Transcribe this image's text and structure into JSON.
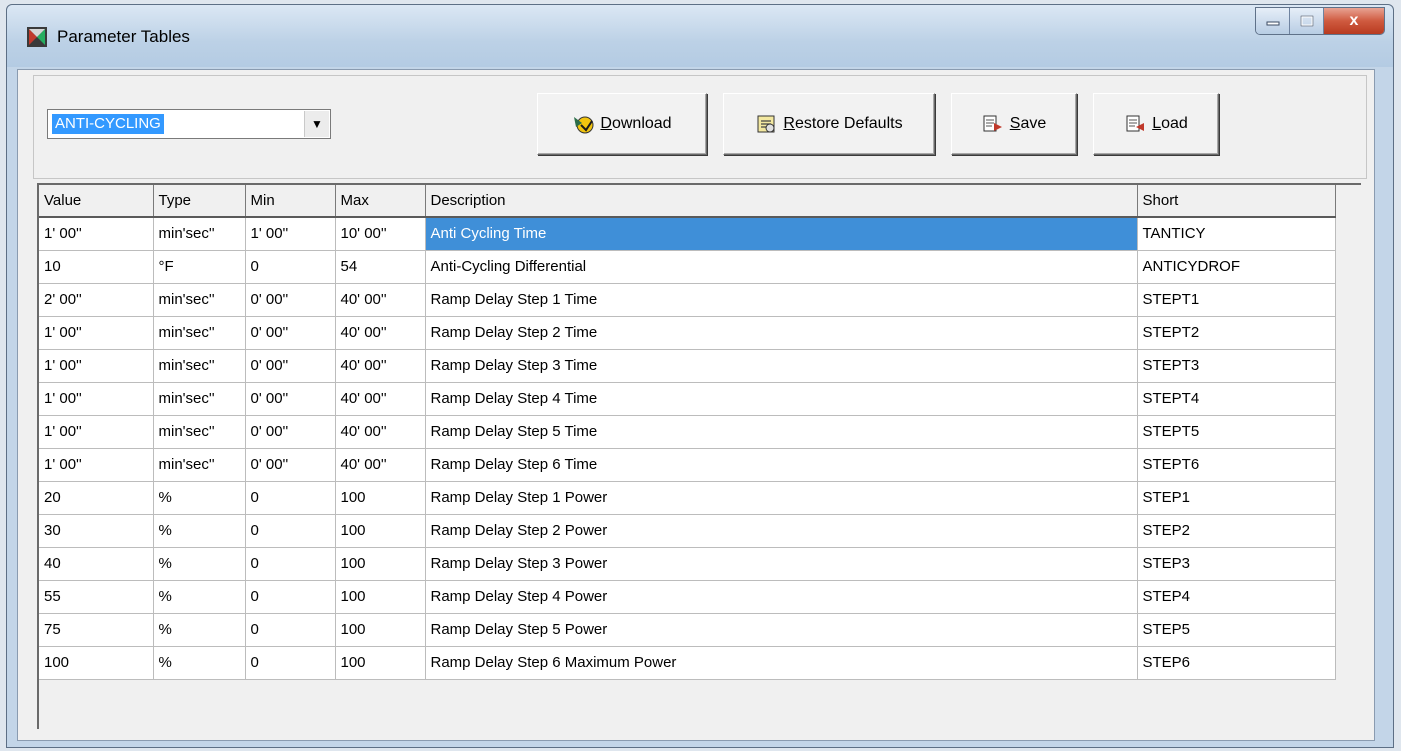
{
  "window": {
    "title": "Parameter Tables",
    "close_glyph": "x"
  },
  "toolbar": {
    "table_select": {
      "selected": "ANTI-CYCLING"
    },
    "buttons": {
      "download": {
        "underline": "D",
        "rest": "ownload",
        "icon": "download-icon"
      },
      "restore": {
        "underline": "R",
        "rest": "estore Defaults",
        "icon": "restore-defaults-icon"
      },
      "save": {
        "underline": "S",
        "rest": "ave",
        "icon": "save-icon"
      },
      "load": {
        "underline": "L",
        "rest": "oad",
        "icon": "load-icon"
      }
    }
  },
  "table": {
    "columns": [
      "Value",
      "Type",
      "Min",
      "Max",
      "Description",
      "Short"
    ],
    "rows": [
      [
        "1' 00''",
        "min'sec''",
        "1' 00''",
        "10' 00''",
        "Anti Cycling Time",
        "TANTICY"
      ],
      [
        "10",
        "°F",
        "0",
        "54",
        "Anti-Cycling Differential",
        "ANTICYDROF"
      ],
      [
        "2' 00''",
        "min'sec''",
        "0' 00''",
        "40' 00''",
        "Ramp Delay Step 1 Time",
        "STEPT1"
      ],
      [
        "1' 00''",
        "min'sec''",
        "0' 00''",
        "40' 00''",
        "Ramp Delay Step 2 Time",
        "STEPT2"
      ],
      [
        "1' 00''",
        "min'sec''",
        "0' 00''",
        "40' 00''",
        "Ramp Delay Step 3 Time",
        "STEPT3"
      ],
      [
        "1' 00''",
        "min'sec''",
        "0' 00''",
        "40' 00''",
        "Ramp Delay Step 4 Time",
        "STEPT4"
      ],
      [
        "1' 00''",
        "min'sec''",
        "0' 00''",
        "40' 00''",
        "Ramp Delay Step 5 Time",
        "STEPT5"
      ],
      [
        "1' 00''",
        "min'sec''",
        "0' 00''",
        "40' 00''",
        "Ramp Delay Step 6 Time",
        "STEPT6"
      ],
      [
        "20",
        "%",
        "0",
        "100",
        "Ramp Delay Step 1 Power",
        "STEP1"
      ],
      [
        "30",
        "%",
        "0",
        "100",
        "Ramp Delay Step 2 Power",
        "STEP2"
      ],
      [
        "40",
        "%",
        "0",
        "100",
        "Ramp Delay Step 3 Power",
        "STEP3"
      ],
      [
        "55",
        "%",
        "0",
        "100",
        "Ramp Delay Step 4 Power",
        "STEP4"
      ],
      [
        "75",
        "%",
        "0",
        "100",
        "Ramp Delay Step 5 Power",
        "STEP5"
      ],
      [
        "100",
        "%",
        "0",
        "100",
        "Ramp Delay Step 6 Maximum Power",
        "STEP6"
      ]
    ]
  },
  "colors": {
    "selection": "#3f8fd8",
    "combo_highlight": "#3399ff",
    "close_button": "#cf5a3f"
  }
}
